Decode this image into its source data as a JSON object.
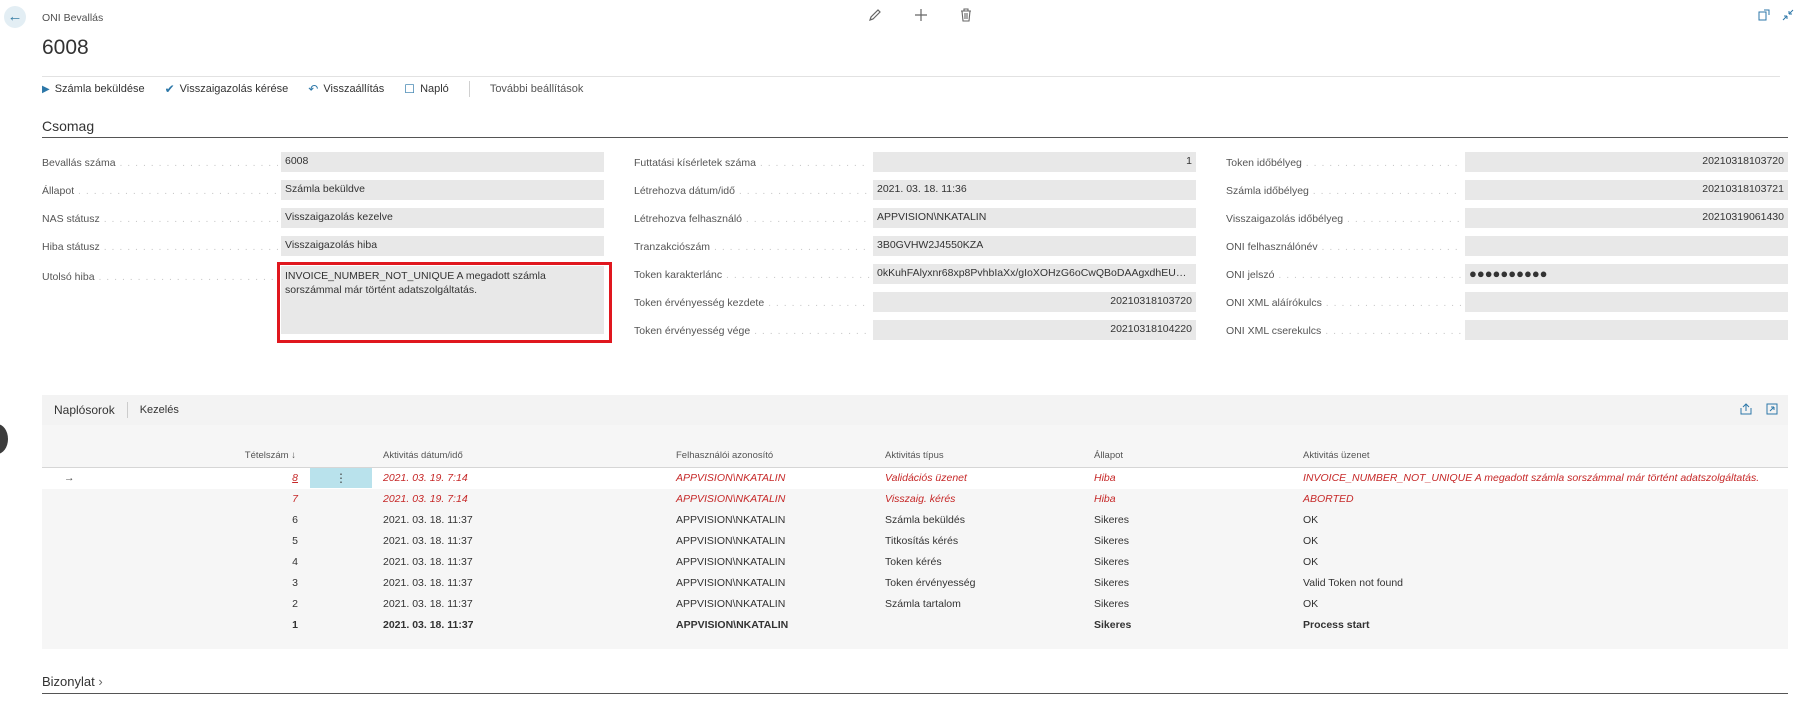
{
  "header": {
    "breadcrumb": "ONI Bevallás",
    "title": "6008",
    "icons": [
      "edit-icon",
      "add-icon",
      "delete-icon",
      "open-new-window-icon",
      "collapse-icon"
    ]
  },
  "actions": [
    {
      "label": "Számla beküldése",
      "icon": "play-icon"
    },
    {
      "label": "Visszaigazolás kérése",
      "icon": "check-icon"
    },
    {
      "label": "Visszaállítás",
      "icon": "undo-icon"
    },
    {
      "label": "Napló",
      "icon": "document-icon"
    },
    {
      "label": "További beállítások",
      "icon": ""
    }
  ],
  "csomag": {
    "title": "Csomag",
    "col1": [
      {
        "label": "Bevallás száma",
        "value": "6008"
      },
      {
        "label": "Állapot",
        "value": "Számla beküldve"
      },
      {
        "label": "NAS státusz",
        "value": "Visszaigazolás kezelve"
      },
      {
        "label": "Hiba státusz",
        "value": "Visszaigazolás hiba"
      },
      {
        "label": "Utolsó hiba",
        "value": "INVOICE_NUMBER_NOT_UNIQUE A megadott számla sorszámmal már történt adatszolgáltatás."
      }
    ],
    "col2": [
      {
        "label": "Futtatási kísérletek száma",
        "value": "1"
      },
      {
        "label": "Létrehozva dátum/idő",
        "value": "2021. 03. 18. 11:36"
      },
      {
        "label": "Létrehozva felhasználó",
        "value": "APPVISION\\NKATALIN"
      },
      {
        "label": "Tranzakciószám",
        "value": "3B0GVHW2J4550KZA"
      },
      {
        "label": "Token karakterlánc",
        "value": "0kKuhFAlyxnr68xp8PvhbIaXx/gIoXOHzG6oCwQBoDAAgxdhEUG3..."
      },
      {
        "label": "Token érvényesség kezdete",
        "value": "20210318103720"
      },
      {
        "label": "Token érvényesség vége",
        "value": "20210318104220"
      }
    ],
    "col3": [
      {
        "label": "Token időbélyeg",
        "value": "20210318103720"
      },
      {
        "label": "Számla időbélyeg",
        "value": "20210318103721"
      },
      {
        "label": "Visszaigazolás időbélyeg",
        "value": "20210319061430"
      },
      {
        "label": "ONI felhasználónév",
        "value": ""
      },
      {
        "label": "ONI jelszó",
        "value": "●●●●●●●●●●"
      },
      {
        "label": "ONI XML aláírókulcs",
        "value": ""
      },
      {
        "label": "ONI XML cserekulcs",
        "value": ""
      }
    ]
  },
  "naplo": {
    "tabs": [
      "Naplósorok",
      "Kezelés"
    ],
    "columns": [
      "Tételszám ↓",
      "Aktivitás dátum/idő",
      "Felhasználói azonosító",
      "Aktivitás típus",
      "Állapot",
      "Aktivitás üzenet"
    ],
    "rows": [
      {
        "no": "8",
        "date": "2021. 03. 19. 7:14",
        "user": "APPVISION\\NKATALIN",
        "type": "Validációs üzenet",
        "status": "Hiba",
        "message": "INVOICE_NUMBER_NOT_UNIQUE A megadott számla sorszámmal már történt adatszolgáltatás.",
        "style": "error"
      },
      {
        "no": "7",
        "date": "2021. 03. 19. 7:14",
        "user": "APPVISION\\NKATALIN",
        "type": "Visszaig. kérés",
        "status": "Hiba",
        "message": "ABORTED",
        "style": "error"
      },
      {
        "no": "6",
        "date": "2021. 03. 18. 11:37",
        "user": "APPVISION\\NKATALIN",
        "type": "Számla beküldés",
        "status": "Sikeres",
        "message": "OK",
        "style": "normal"
      },
      {
        "no": "5",
        "date": "2021. 03. 18. 11:37",
        "user": "APPVISION\\NKATALIN",
        "type": "Titkosítás kérés",
        "status": "Sikeres",
        "message": "OK",
        "style": "normal"
      },
      {
        "no": "4",
        "date": "2021. 03. 18. 11:37",
        "user": "APPVISION\\NKATALIN",
        "type": "Token kérés",
        "status": "Sikeres",
        "message": "OK",
        "style": "normal"
      },
      {
        "no": "3",
        "date": "2021. 03. 18. 11:37",
        "user": "APPVISION\\NKATALIN",
        "type": "Token érvényesség",
        "status": "Sikeres",
        "message": "Valid Token not found",
        "style": "normal"
      },
      {
        "no": "2",
        "date": "2021. 03. 18. 11:37",
        "user": "APPVISION\\NKATALIN",
        "type": "Számla tartalom",
        "status": "Sikeres",
        "message": "OK",
        "style": "normal"
      },
      {
        "no": "1",
        "date": "2021. 03. 18. 11:37",
        "user": "APPVISION\\NKATALIN",
        "type": "",
        "status": "Sikeres",
        "message": "Process start",
        "style": "bold"
      }
    ]
  },
  "bizonylat": {
    "title": "Bizonylat"
  }
}
